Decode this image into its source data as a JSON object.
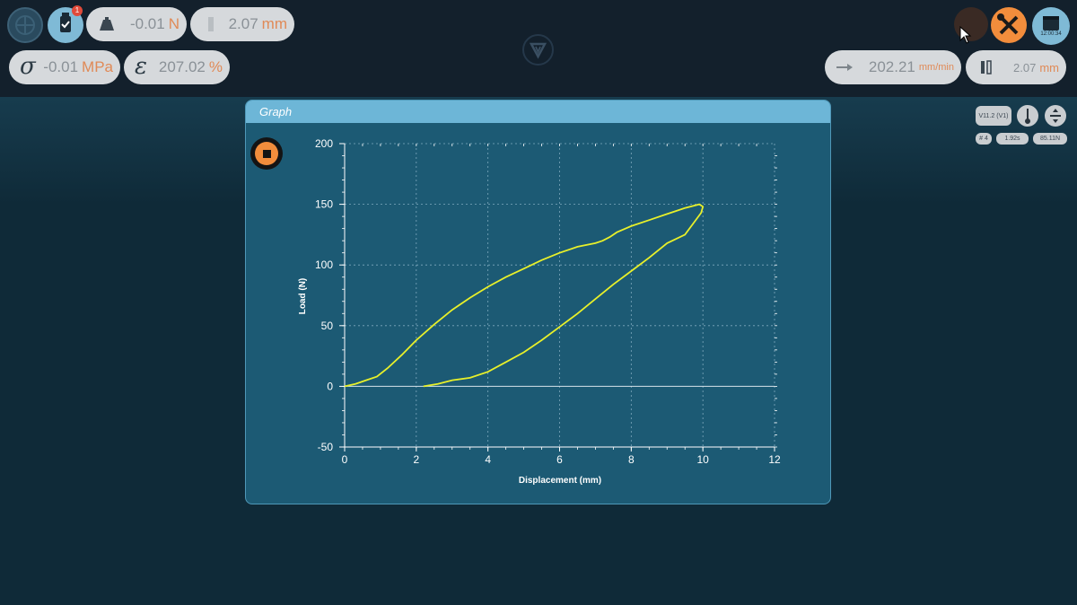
{
  "readouts": {
    "load": {
      "value": "-0.01",
      "unit": "N"
    },
    "position": {
      "value": "2.07",
      "unit": "mm"
    },
    "stress": {
      "symbol": "σ",
      "value": "-0.01",
      "unit": "MPa"
    },
    "strain": {
      "symbol": "ε",
      "value": "207.02",
      "unit": "%"
    },
    "speed": {
      "value": "202.21",
      "unit": "mm/min"
    },
    "gap": {
      "value": "2.07",
      "unit": "mm"
    }
  },
  "badges": {
    "notification_count": "1"
  },
  "clock": {
    "time": "12:00:34"
  },
  "side_info": {
    "version": "V11.2 (V1)",
    "sample": "# 4",
    "time": "1.92s",
    "force": "85.11N"
  },
  "icons": [
    "globe-icon",
    "usb-check-icon",
    "weight-icon",
    "ruler-icon",
    "logo-triangle-icon",
    "tools-icon",
    "calendar-clock-icon",
    "speed-arrow-icon",
    "gap-icon",
    "thermometer-icon",
    "align-icon",
    "stop-icon"
  ],
  "colors": {
    "accent": "#f28d3c",
    "curve": "#e8f02a",
    "panel": "#1c5a74",
    "header": "#6db6d7"
  },
  "panel": {
    "title": "Graph"
  },
  "chart_data": {
    "type": "line",
    "xlabel": "Displacement (mm)",
    "ylabel": "Load (N)",
    "xlim": [
      0,
      12
    ],
    "ylim": [
      -50,
      200
    ],
    "xticks": [
      0,
      2,
      4,
      6,
      8,
      10,
      12
    ],
    "yticks": [
      -50,
      0,
      50,
      100,
      150,
      200
    ],
    "grid": true,
    "series": [
      {
        "x": [
          0,
          0.3,
          0.6,
          0.9,
          1.2,
          1.6,
          2.0,
          2.5,
          3.0,
          3.5,
          4.0,
          4.5,
          5.0,
          5.5,
          6.0,
          6.5,
          7.0,
          7.2,
          7.4,
          7.6,
          8.0,
          8.5,
          9.0,
          9.5,
          9.9,
          10.0,
          9.95,
          9.7,
          9.5,
          9.0,
          8.5,
          8.0,
          7.5,
          7.0,
          6.5,
          6.0,
          5.5,
          5.0,
          4.5,
          4.0,
          3.5,
          3.0,
          2.6,
          2.2
        ],
        "y": [
          0,
          2,
          5,
          8,
          15,
          26,
          38,
          51,
          63,
          73,
          82,
          90,
          97,
          104,
          110,
          115,
          118,
          120,
          123,
          127,
          132,
          137,
          142,
          147,
          150,
          148,
          143,
          133,
          125,
          118,
          106,
          95,
          84,
          72,
          60,
          49,
          38,
          28,
          20,
          12,
          7,
          5,
          2,
          0
        ]
      }
    ]
  }
}
